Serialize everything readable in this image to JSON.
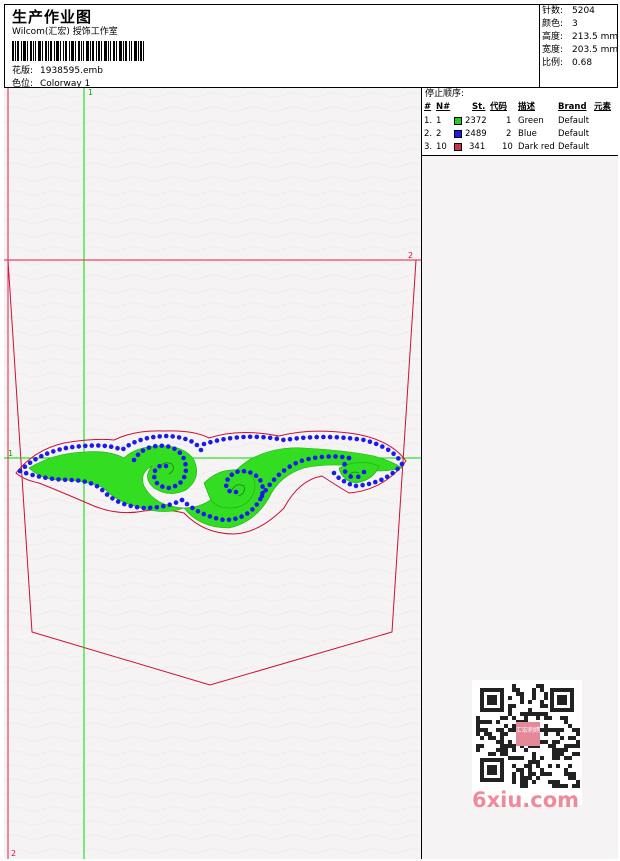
{
  "header": {
    "title": "生产作业图",
    "company": "Wilcom(汇宏) 授饰工作室",
    "design_label": "花版:",
    "design_value": "1938595.emb",
    "colorway_label": "色位:",
    "colorway_value": "Colorway 1"
  },
  "stats": [
    {
      "label": "针数:",
      "value": "5204"
    },
    {
      "label": "颜色:",
      "value": "3"
    },
    {
      "label": "高度:",
      "value": "213.5 mm"
    },
    {
      "label": "宽度:",
      "value": "203.5 mm"
    },
    {
      "label": "比例:",
      "value": "0.68"
    }
  ],
  "sequence": {
    "title": "停止顺序:",
    "headers": [
      "#",
      "N#",
      "St.",
      "代码",
      "描述",
      "Brand",
      "元素"
    ],
    "rows": [
      {
        "idx": "1.",
        "n": "1",
        "st": "2372",
        "code": "1",
        "desc": "Green",
        "brand": "Default",
        "color": "#22cc22"
      },
      {
        "idx": "2.",
        "n": "2",
        "st": "2489",
        "code": "2",
        "desc": "Blue",
        "brand": "Default",
        "color": "#1a1aee"
      },
      {
        "idx": "3.",
        "n": "10",
        "st": "341",
        "code": "10",
        "desc": "Dark red",
        "brand": "Default",
        "color": "#cc3344"
      }
    ]
  },
  "guides": {
    "v1_label": "1",
    "h1_label": "1",
    "h2_label": "2",
    "v2_label": "2"
  },
  "watermark": "6xiu.com",
  "qr_center_text": "汇宏刺绣",
  "colors": {
    "guide_green": "#00dd00",
    "guide_red": "#dd2244",
    "outline_red": "#cc1133",
    "fill_green": "#33dd22",
    "bead_blue": "#1a1aee",
    "background": "#f6f3f5"
  }
}
